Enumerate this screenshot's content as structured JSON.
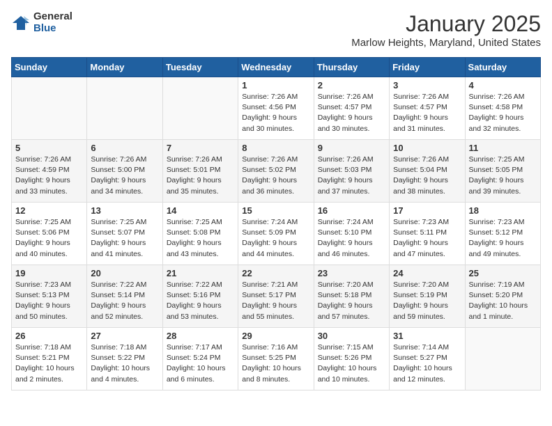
{
  "logo": {
    "general": "General",
    "blue": "Blue"
  },
  "title": "January 2025",
  "location": "Marlow Heights, Maryland, United States",
  "weekdays": [
    "Sunday",
    "Monday",
    "Tuesday",
    "Wednesday",
    "Thursday",
    "Friday",
    "Saturday"
  ],
  "weeks": [
    [
      {
        "day": "",
        "info": ""
      },
      {
        "day": "",
        "info": ""
      },
      {
        "day": "",
        "info": ""
      },
      {
        "day": "1",
        "info": "Sunrise: 7:26 AM\nSunset: 4:56 PM\nDaylight: 9 hours\nand 30 minutes."
      },
      {
        "day": "2",
        "info": "Sunrise: 7:26 AM\nSunset: 4:57 PM\nDaylight: 9 hours\nand 30 minutes."
      },
      {
        "day": "3",
        "info": "Sunrise: 7:26 AM\nSunset: 4:57 PM\nDaylight: 9 hours\nand 31 minutes."
      },
      {
        "day": "4",
        "info": "Sunrise: 7:26 AM\nSunset: 4:58 PM\nDaylight: 9 hours\nand 32 minutes."
      }
    ],
    [
      {
        "day": "5",
        "info": "Sunrise: 7:26 AM\nSunset: 4:59 PM\nDaylight: 9 hours\nand 33 minutes."
      },
      {
        "day": "6",
        "info": "Sunrise: 7:26 AM\nSunset: 5:00 PM\nDaylight: 9 hours\nand 34 minutes."
      },
      {
        "day": "7",
        "info": "Sunrise: 7:26 AM\nSunset: 5:01 PM\nDaylight: 9 hours\nand 35 minutes."
      },
      {
        "day": "8",
        "info": "Sunrise: 7:26 AM\nSunset: 5:02 PM\nDaylight: 9 hours\nand 36 minutes."
      },
      {
        "day": "9",
        "info": "Sunrise: 7:26 AM\nSunset: 5:03 PM\nDaylight: 9 hours\nand 37 minutes."
      },
      {
        "day": "10",
        "info": "Sunrise: 7:26 AM\nSunset: 5:04 PM\nDaylight: 9 hours\nand 38 minutes."
      },
      {
        "day": "11",
        "info": "Sunrise: 7:25 AM\nSunset: 5:05 PM\nDaylight: 9 hours\nand 39 minutes."
      }
    ],
    [
      {
        "day": "12",
        "info": "Sunrise: 7:25 AM\nSunset: 5:06 PM\nDaylight: 9 hours\nand 40 minutes."
      },
      {
        "day": "13",
        "info": "Sunrise: 7:25 AM\nSunset: 5:07 PM\nDaylight: 9 hours\nand 41 minutes."
      },
      {
        "day": "14",
        "info": "Sunrise: 7:25 AM\nSunset: 5:08 PM\nDaylight: 9 hours\nand 43 minutes."
      },
      {
        "day": "15",
        "info": "Sunrise: 7:24 AM\nSunset: 5:09 PM\nDaylight: 9 hours\nand 44 minutes."
      },
      {
        "day": "16",
        "info": "Sunrise: 7:24 AM\nSunset: 5:10 PM\nDaylight: 9 hours\nand 46 minutes."
      },
      {
        "day": "17",
        "info": "Sunrise: 7:23 AM\nSunset: 5:11 PM\nDaylight: 9 hours\nand 47 minutes."
      },
      {
        "day": "18",
        "info": "Sunrise: 7:23 AM\nSunset: 5:12 PM\nDaylight: 9 hours\nand 49 minutes."
      }
    ],
    [
      {
        "day": "19",
        "info": "Sunrise: 7:23 AM\nSunset: 5:13 PM\nDaylight: 9 hours\nand 50 minutes."
      },
      {
        "day": "20",
        "info": "Sunrise: 7:22 AM\nSunset: 5:14 PM\nDaylight: 9 hours\nand 52 minutes."
      },
      {
        "day": "21",
        "info": "Sunrise: 7:22 AM\nSunset: 5:16 PM\nDaylight: 9 hours\nand 53 minutes."
      },
      {
        "day": "22",
        "info": "Sunrise: 7:21 AM\nSunset: 5:17 PM\nDaylight: 9 hours\nand 55 minutes."
      },
      {
        "day": "23",
        "info": "Sunrise: 7:20 AM\nSunset: 5:18 PM\nDaylight: 9 hours\nand 57 minutes."
      },
      {
        "day": "24",
        "info": "Sunrise: 7:20 AM\nSunset: 5:19 PM\nDaylight: 9 hours\nand 59 minutes."
      },
      {
        "day": "25",
        "info": "Sunrise: 7:19 AM\nSunset: 5:20 PM\nDaylight: 10 hours\nand 1 minute."
      }
    ],
    [
      {
        "day": "26",
        "info": "Sunrise: 7:18 AM\nSunset: 5:21 PM\nDaylight: 10 hours\nand 2 minutes."
      },
      {
        "day": "27",
        "info": "Sunrise: 7:18 AM\nSunset: 5:22 PM\nDaylight: 10 hours\nand 4 minutes."
      },
      {
        "day": "28",
        "info": "Sunrise: 7:17 AM\nSunset: 5:24 PM\nDaylight: 10 hours\nand 6 minutes."
      },
      {
        "day": "29",
        "info": "Sunrise: 7:16 AM\nSunset: 5:25 PM\nDaylight: 10 hours\nand 8 minutes."
      },
      {
        "day": "30",
        "info": "Sunrise: 7:15 AM\nSunset: 5:26 PM\nDaylight: 10 hours\nand 10 minutes."
      },
      {
        "day": "31",
        "info": "Sunrise: 7:14 AM\nSunset: 5:27 PM\nDaylight: 10 hours\nand 12 minutes."
      },
      {
        "day": "",
        "info": ""
      }
    ]
  ]
}
